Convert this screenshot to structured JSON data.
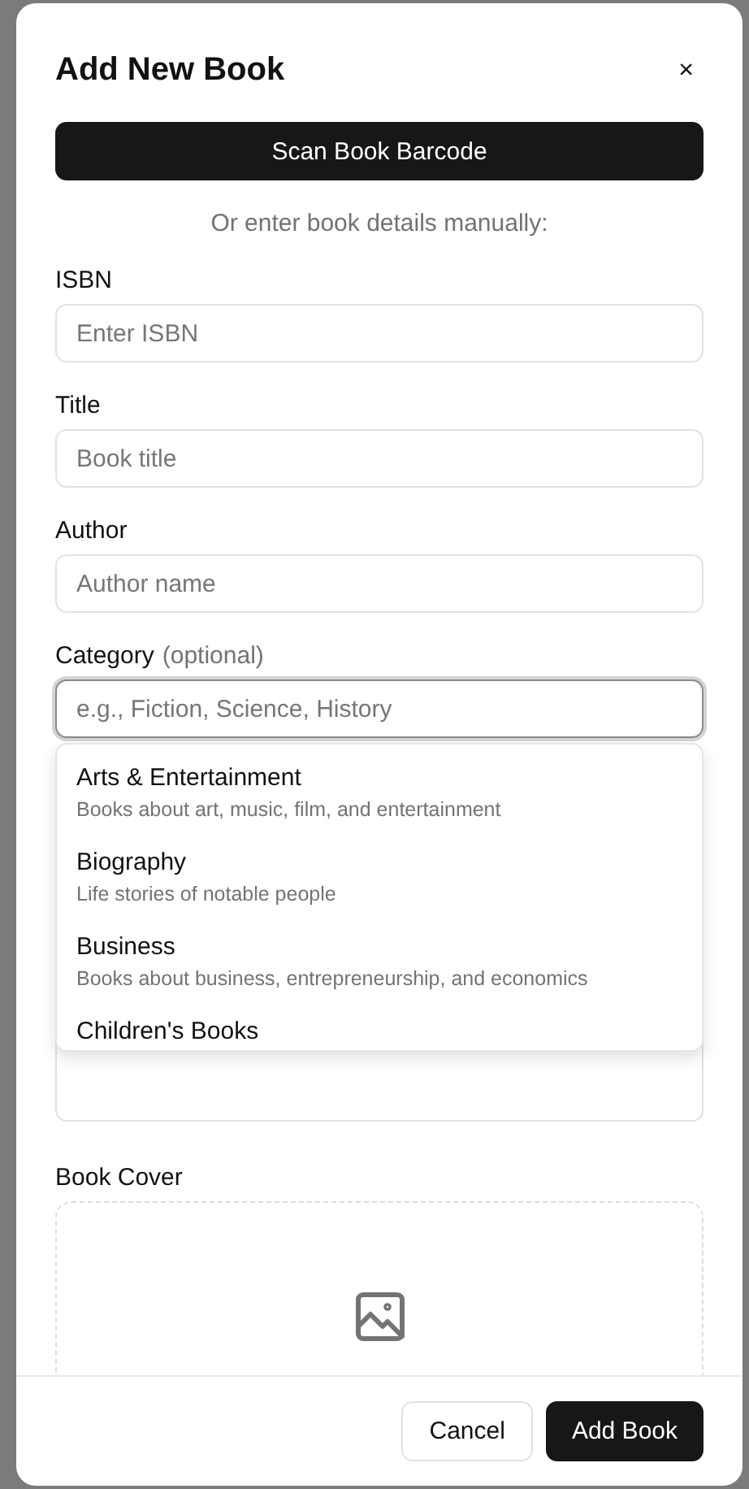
{
  "dialog": {
    "title": "Add New Book",
    "close": "×"
  },
  "scan_button": "Scan Book Barcode",
  "divider_text": "Or enter book details manually:",
  "fields": [
    {
      "label": "ISBN",
      "placeholder": "Enter ISBN",
      "focused": false
    },
    {
      "label": "Title",
      "placeholder": "Book title",
      "focused": false
    },
    {
      "label": "Author",
      "placeholder": "Author name",
      "focused": false
    },
    {
      "label": "Category",
      "hint": "(optional)",
      "placeholder": "e.g., Fiction, Science, History",
      "focused": true
    }
  ],
  "category_options": [
    {
      "name": "Arts & Entertainment",
      "description": "Books about art, music, film, and entertainment"
    },
    {
      "name": "Biography",
      "description": "Life stories of notable people"
    },
    {
      "name": "Business",
      "description": "Books about business, entrepreneurship, and economics"
    },
    {
      "name": "Children's Books"
    }
  ],
  "cover": {
    "label": "Book Cover"
  },
  "footer": {
    "cancel": "Cancel",
    "submit": "Add Book"
  }
}
